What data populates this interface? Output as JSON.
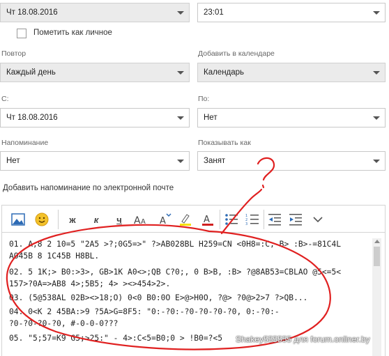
{
  "date_top": {
    "value": "Чт 18.08.2016"
  },
  "time_top": {
    "value": "23:01"
  },
  "private_checkbox": {
    "label": "Пометить как личное",
    "checked": false
  },
  "repeat": {
    "label": "Повтор",
    "value": "Каждый день"
  },
  "add_to_calendar": {
    "label": "Добавить в календаре",
    "value": "Календарь"
  },
  "from": {
    "label": "С:",
    "value": "Чт 18.08.2016"
  },
  "to": {
    "label": "По:",
    "value": "Нет"
  },
  "reminder": {
    "label": "Напоминание",
    "value": "Нет"
  },
  "show_as": {
    "label": "Показывать как",
    "value": "Занят"
  },
  "email_reminder": {
    "label": "Добавить напоминание по электронной почте"
  },
  "toolbar": {
    "bold": "ж",
    "italic": "к",
    "underline": "ч",
    "items": [
      "image-icon",
      "emoji-icon",
      "bold",
      "italic",
      "underline",
      "font-size-icon",
      "font-size-down-icon",
      "highlight-icon",
      "font-color-icon",
      "bullets-icon",
      "numbering-icon",
      "outdent-icon",
      "indent-icon",
      "more-icon"
    ]
  },
  "body_lines": [
    "01. A,8 2 10=5 \"2A5 >?;0G5=>\" ?>AB028BL H259=CN <0H8=:C, B> :B>-=81C4L",
    "AO45B 8 1C45B H8BL.",
    "02. 5 1K;> B0:>3>, GB>1K A0<>;QB C?0;, 0 B>B, :B> ?@8AB53=CBLAO @5<=5<",
    "157>?0A=>AB8 4>;5B5; 4> ><>454>2>.",
    "03. (5@538AL 02B><>18;O) 0<0 B0:0O E>@>H0O, ?@> ?0@>2>7 ?>QB...",
    "04. 0<K 2 45BA:>9 ?5A>G=8F5: \"0:-?0:-?0-?0-?0-?0, 0:-?0:-",
    "?0-?0-?0-?0, #-0-0-0???",
    "05. \"5;57=K9 G5;>25:\" - 4>:C<5=B0;0 > !B0=?<5"
  ],
  "watermark": "Shakey555555 для forum.onliner.by",
  "annotation_color": "#e02020"
}
